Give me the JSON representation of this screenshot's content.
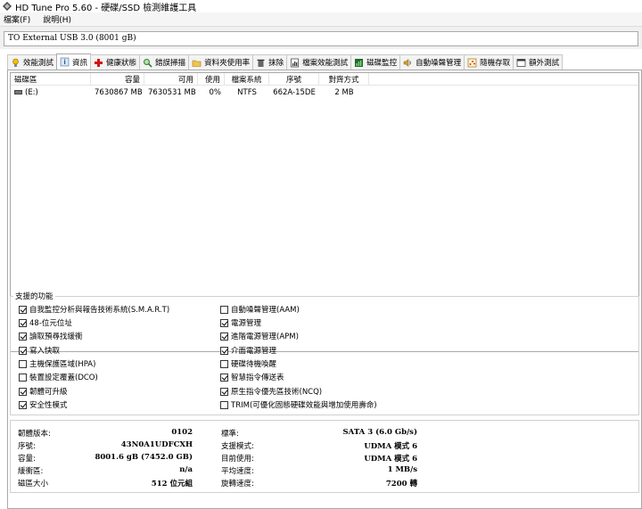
{
  "window": {
    "title": "HD Tune Pro 5.60 - 硬碟/SSD 檢測維護工具"
  },
  "menu": {
    "items": [
      "檔案(F)",
      "說明(H)"
    ]
  },
  "drive_select": {
    "value": "TO External USB 3.0 (8001 gB)"
  },
  "tabs": [
    {
      "label": "效能測試",
      "icon": "lightbulb-icon"
    },
    {
      "label": "資訊",
      "icon": "info-icon"
    },
    {
      "label": "健康狀態",
      "icon": "health-cross-icon"
    },
    {
      "label": "錯誤掃描",
      "icon": "magnifier-icon"
    },
    {
      "label": "資料夾使用率",
      "icon": "folder-icon"
    },
    {
      "label": "抹除",
      "icon": "trash-icon"
    },
    {
      "label": "檔案效能測試",
      "icon": "file-benchmark-icon"
    },
    {
      "label": "磁碟監控",
      "icon": "monitor-chart-icon"
    },
    {
      "label": "自動噪聲管理",
      "icon": "speaker-icon"
    },
    {
      "label": "隨機存取",
      "icon": "random-access-icon"
    },
    {
      "label": "額外測試",
      "icon": "extra-tests-icon"
    }
  ],
  "partitions": {
    "headers": [
      "磁碟區",
      "容量",
      "可用",
      "使用",
      "檔案系統",
      "序號",
      "對齊方式"
    ],
    "rows": [
      [
        "(E:)",
        "7630867 MB",
        "7630531 MB",
        "0%",
        "NTFS",
        "662A-15DE",
        "2 MB"
      ]
    ]
  },
  "features": {
    "title": "支援的功能",
    "left": [
      {
        "label": "自我監控分析與報告技術系統(S.M.A.R.T)",
        "checked": true
      },
      {
        "label": "48-位元位址",
        "checked": true
      },
      {
        "label": "讀取預尋找緩衝",
        "checked": true
      },
      {
        "label": "寫入快取",
        "checked": true
      },
      {
        "label": "主機保護區域(HPA)",
        "checked": false
      },
      {
        "label": "裝置設定覆蓋(DCO)",
        "checked": false
      },
      {
        "label": "韌體可升級",
        "checked": true
      },
      {
        "label": "安全性模式",
        "checked": true
      }
    ],
    "right": [
      {
        "label": "自動噪聲管理(AAM)",
        "checked": false
      },
      {
        "label": "電源管理",
        "checked": true
      },
      {
        "label": "進階電源管理(APM)",
        "checked": true
      },
      {
        "label": "介面電源管理",
        "checked": true
      },
      {
        "label": "硬碟待機喚醒",
        "checked": false
      },
      {
        "label": "智慧指令傳送表",
        "checked": true
      },
      {
        "label": "原生指令優先區技術(NCQ)",
        "checked": true
      },
      {
        "label": "TRIM(可優化固態硬碟效能與增加使用壽命)",
        "checked": false
      }
    ]
  },
  "info": {
    "left": [
      {
        "label": "韌體版本:",
        "value": "0102"
      },
      {
        "label": "序號:",
        "value": "43N0A1UDFCXH"
      },
      {
        "label": "容量:",
        "value": "8001.6 gB (7452.0 GB)"
      },
      {
        "label": "緩衝區:",
        "value": "n/a"
      },
      {
        "label": "磁區大小",
        "value": "512 位元組"
      }
    ],
    "right": [
      {
        "label": "標準:",
        "value": "SATA 3 (6.0 Gb/s)"
      },
      {
        "label": "支援模式:",
        "value": "UDMA 模式 6"
      },
      {
        "label": "目前使用:",
        "value": "UDMA 模式 6"
      },
      {
        "label": "平均速度:",
        "value": "1 MB/s"
      },
      {
        "label": "旋轉速度:",
        "value": "7200 轉"
      }
    ]
  }
}
